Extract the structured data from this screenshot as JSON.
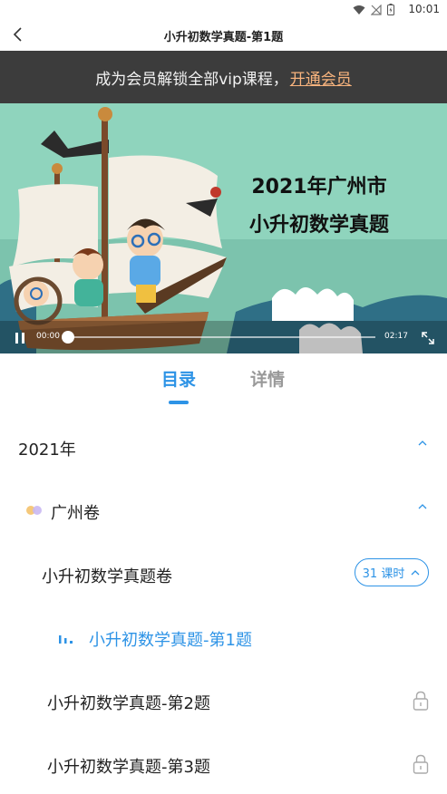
{
  "status_bar": {
    "time": "10:01",
    "icons": [
      "wifi-icon",
      "signal-off-icon",
      "battery-icon"
    ]
  },
  "nav": {
    "title": "小升初数学真题-第1题",
    "back_icon": "chevron-left-icon"
  },
  "banner": {
    "text": "成为会员解锁全部vip课程，",
    "link": "开通会员"
  },
  "video": {
    "title_line1": "2021年广州市",
    "title_line2": "小升初数学真题",
    "current_time": "00:00",
    "duration": "02:17",
    "progress": 0
  },
  "tabs": [
    {
      "label": "目录",
      "active": true
    },
    {
      "label": "详情",
      "active": false
    }
  ],
  "catalog": {
    "year": "2021年",
    "area": "广州卷",
    "paper": {
      "title": "小升初数学真题卷",
      "badge": "31 课时"
    },
    "lessons": [
      {
        "title": "小升初数学真题-第1题",
        "playing": true,
        "locked": false
      },
      {
        "title": "小升初数学真题-第2题",
        "playing": false,
        "locked": true
      },
      {
        "title": "小升初数学真题-第3题",
        "playing": false,
        "locked": true
      }
    ]
  },
  "colors": {
    "accent": "#2d93e6",
    "banner_bg": "#3c3c3c",
    "banner_link": "#f7b37d",
    "sea": "#7fcfb5"
  }
}
